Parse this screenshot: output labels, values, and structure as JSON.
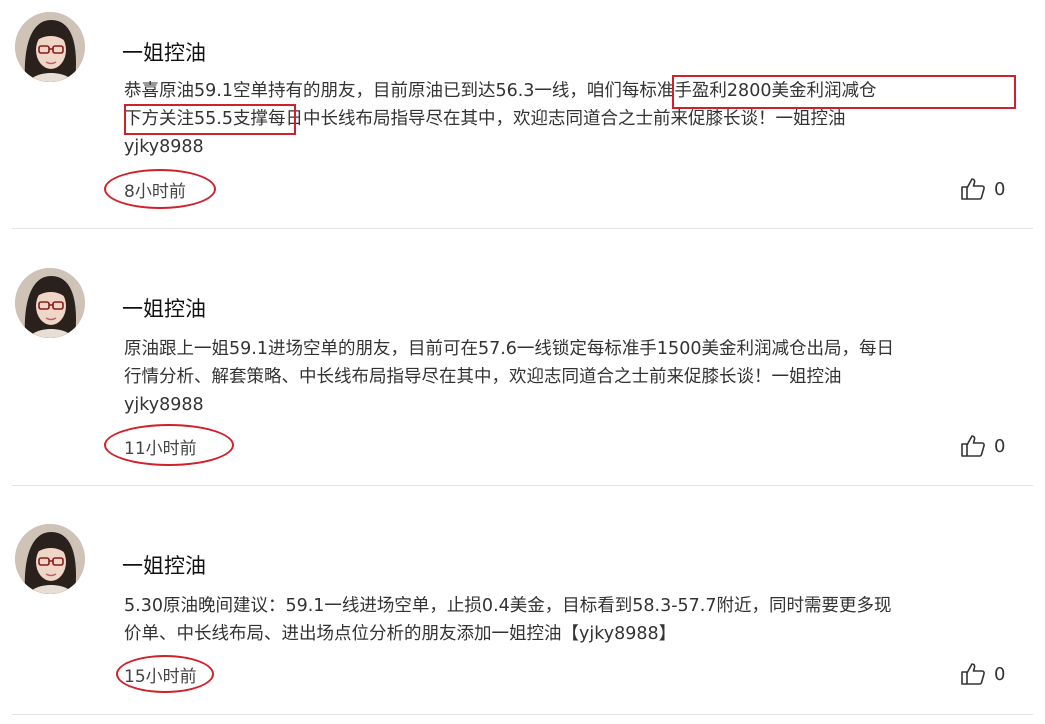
{
  "posts": [
    {
      "author": "一姐控油",
      "lines": [
        "恭喜原油59.1空单持有的朋友，目前原油已到达56.3一线，咱们每标准手盈利2800美金利润减仓",
        "下方关注55.5支撑每日中长线布局指导尽在其中，欢迎志同道合之士前来促膝长谈！一姐控油",
        "yjky8988"
      ],
      "time": "8小时前",
      "likes": "0"
    },
    {
      "author": "一姐控油",
      "lines": [
        "原油跟上一姐59.1进场空单的朋友，目前可在57.6一线锁定每标准手1500美金利润减仓出局，每日",
        "行情分析、解套策略、中长线布局指导尽在其中，欢迎志同道合之士前来促膝长谈！一姐控油",
        "yjky8988"
      ],
      "time": "11小时前",
      "likes": "0"
    },
    {
      "author": "一姐控油",
      "lines": [
        "5.30原油晚间建议：59.1一线进场空单，止损0.4美金，目标看到58.3-57.7附近，同时需要更多现",
        "价单、中长线布局、进出场点位分析的朋友添加一姐控油【yjky8988】"
      ],
      "time": "15小时前",
      "likes": "0"
    }
  ],
  "icons": {
    "like": "thumbs-up-icon",
    "avatar": "woman-with-glasses-avatar"
  },
  "colors": {
    "annotation": "#d0202a",
    "divider": "#e3e3e3"
  }
}
